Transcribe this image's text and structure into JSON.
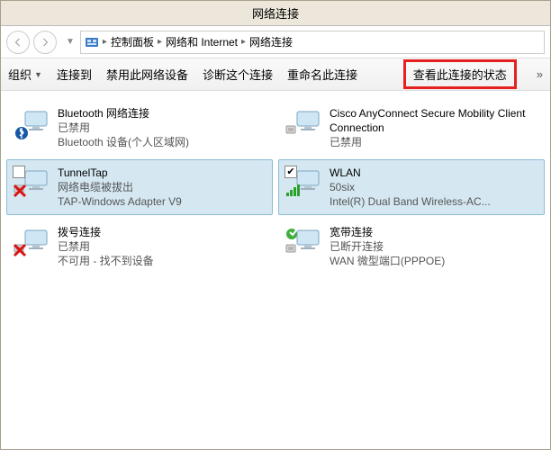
{
  "window": {
    "title": "网络连接"
  },
  "breadcrumbs": {
    "icon": "control-panel",
    "parts": [
      "控制面板",
      "网络和 Internet",
      "网络连接"
    ]
  },
  "toolbar": {
    "organize": "组织",
    "connect": "连接到",
    "disable": "禁用此网络设备",
    "diagnose": "诊断这个连接",
    "rename": "重命名此连接",
    "viewstatus": "查看此连接的状态"
  },
  "connections": [
    {
      "name": "Bluetooth 网络连接",
      "status": "已禁用",
      "device": "Bluetooth 设备(个人区域网)",
      "icon": "bluetooth",
      "selected": false,
      "checked": false,
      "showCheckbox": false
    },
    {
      "name": "Cisco AnyConnect Secure Mobility Client Connection",
      "status": "已禁用",
      "device": "",
      "icon": "vpn",
      "selected": false,
      "checked": false,
      "showCheckbox": false
    },
    {
      "name": "TunnelTap",
      "status": "网络电缆被拔出",
      "device": "TAP-Windows Adapter V9",
      "icon": "lan-disconnected",
      "selected": true,
      "checked": false,
      "showCheckbox": true
    },
    {
      "name": "WLAN",
      "status": "50six",
      "device": "Intel(R) Dual Band Wireless-AC...",
      "icon": "wifi",
      "selected": true,
      "checked": true,
      "showCheckbox": true
    },
    {
      "name": "拨号连接",
      "status": "已禁用",
      "device": "不可用 - 找不到设备",
      "icon": "dialup-disconnected",
      "selected": false,
      "checked": false,
      "showCheckbox": false
    },
    {
      "name": "宽带连接",
      "status": "已断开连接",
      "device": "WAN 微型端口(PPPOE)",
      "icon": "broadband",
      "selected": false,
      "checked": false,
      "showCheckbox": false
    }
  ]
}
